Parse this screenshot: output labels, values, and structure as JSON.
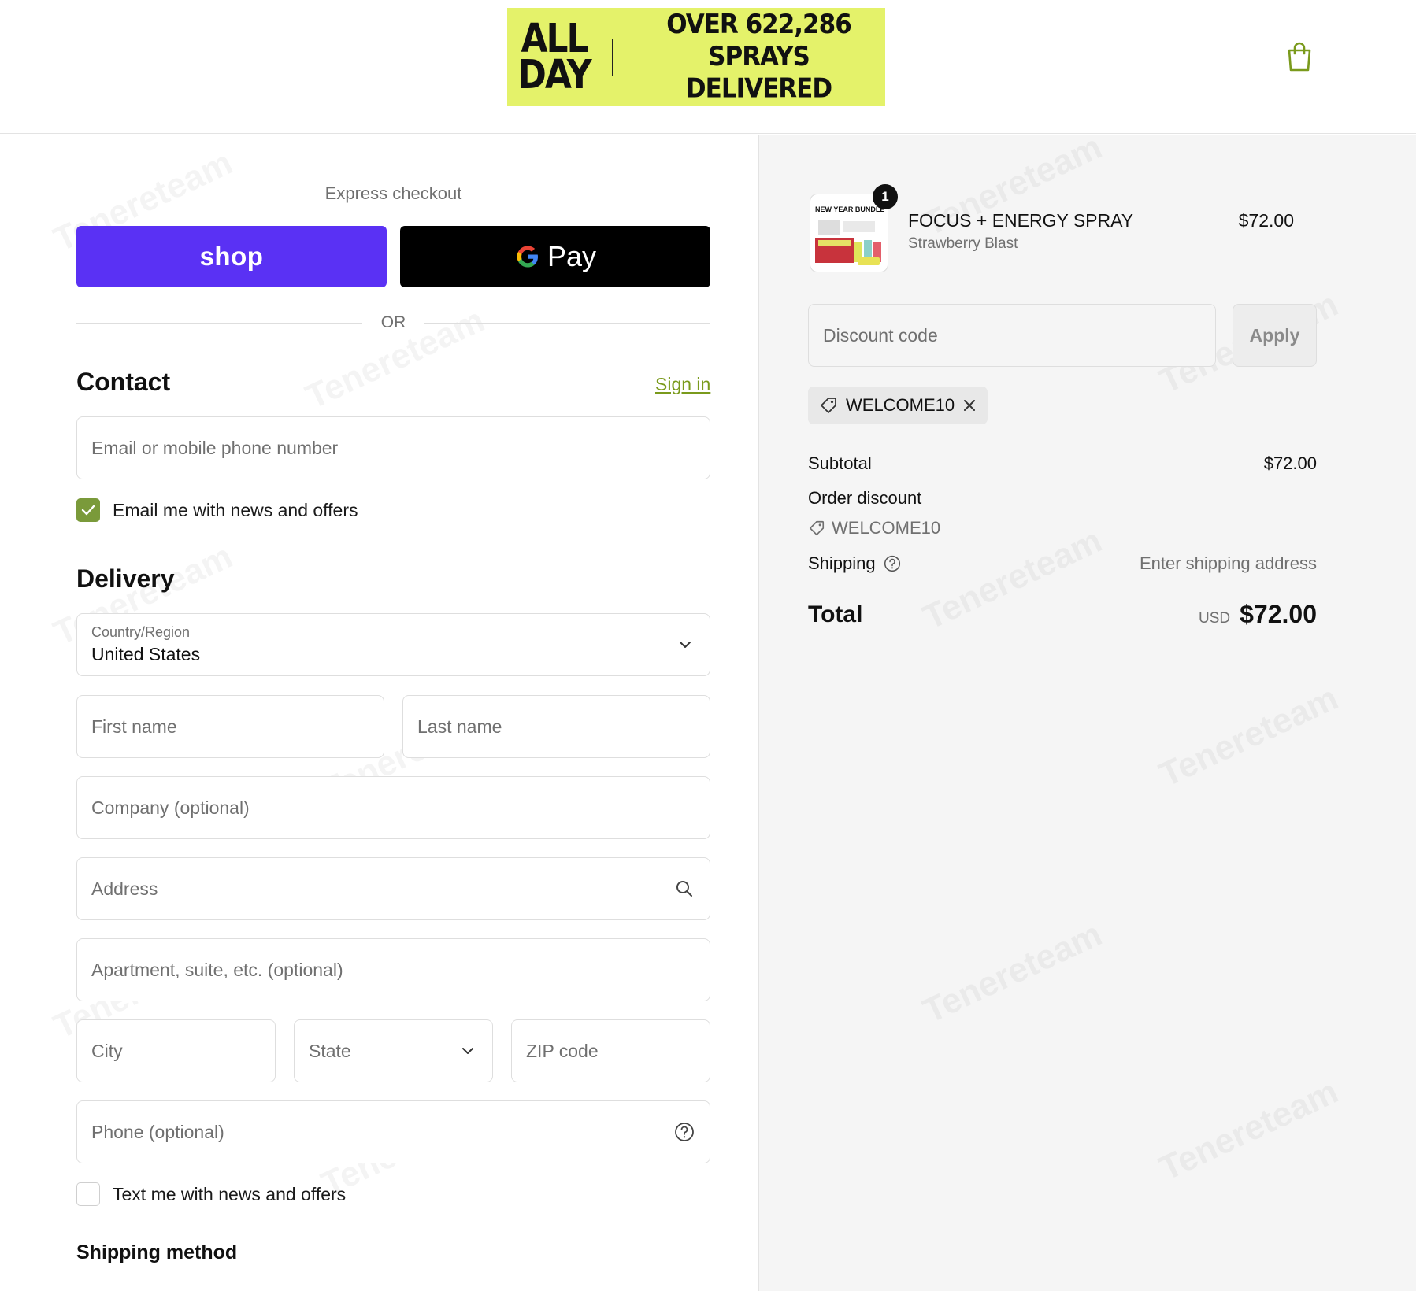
{
  "header": {
    "banner": {
      "logo_line1": "ALL",
      "logo_line2": "DAY",
      "text_line1": "OVER 622,286",
      "text_line2": "SPRAYS DELIVERED",
      "background_color": "#e4f26a"
    },
    "cart_icon": "shopping-bag-icon",
    "accent_color": "#7a9a1c"
  },
  "checkout": {
    "express_label": "Express checkout",
    "shop_label": "shop",
    "gpay_label": "Pay",
    "or_label": "OR",
    "contact": {
      "title": "Contact",
      "signin_label": "Sign in",
      "email_placeholder": "Email or mobile phone number",
      "news_checkbox_label": "Email me with news and offers",
      "news_checked": true
    },
    "delivery": {
      "title": "Delivery",
      "country_label": "Country/Region",
      "country_value": "United States",
      "first_name_placeholder": "First name",
      "last_name_placeholder": "Last name",
      "company_placeholder": "Company (optional)",
      "address_placeholder": "Address",
      "apartment_placeholder": "Apartment, suite, etc. (optional)",
      "city_placeholder": "City",
      "state_placeholder": "State",
      "zip_placeholder": "ZIP code",
      "phone_placeholder": "Phone (optional)",
      "text_checkbox_label": "Text me with news and offers",
      "text_checked": false
    },
    "shipping_method_title": "Shipping method"
  },
  "summary": {
    "product": {
      "quantity": "1",
      "name": "FOCUS + ENERGY SPRAY",
      "variant": "Strawberry Blast",
      "price": "$72.00",
      "thumbnail_caption": "NEW YEAR BUNDLE"
    },
    "discount_placeholder": "Discount code",
    "apply_label": "Apply",
    "applied_code": "WELCOME10",
    "subtotal_label": "Subtotal",
    "subtotal_value": "$72.00",
    "order_discount_label": "Order discount",
    "order_discount_code": "WELCOME10",
    "shipping_label": "Shipping",
    "shipping_value": "Enter shipping address",
    "total_label": "Total",
    "total_currency": "USD",
    "total_value": "$72.00"
  }
}
